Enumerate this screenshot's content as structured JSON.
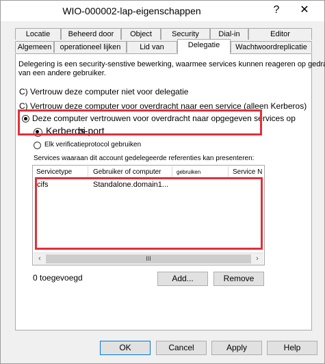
{
  "window": {
    "title": "WIO-000002-lap-eigenschappen",
    "help_glyph": "?",
    "close_glyph": "✕"
  },
  "tabs": {
    "row1": [
      "Locatie",
      "Beheerd door",
      "Object",
      "Security",
      "Dial-in",
      "Editor"
    ],
    "row2": [
      "Algemeen",
      "operationeel lijken",
      "Lid van",
      "Delegatie",
      "Wachtwoordreplicatie"
    ],
    "active": "Delegatie"
  },
  "delegation": {
    "description": "Delegering is een security-senstive bewerking, waarmee services kunnen reageren op gedrag van een andere gebruiker.",
    "description_line1": "Delegering is een security-senstive bewerking, waarmee services kunnen reageren op gedrag",
    "description_line2": "van een andere gebruiker.",
    "option_no_delegation": "C) Vertrouw deze computer niet voor delegatie",
    "option_kerberos_only": "C) Vertrouw deze computer voor overdracht naar een service (alleen Kerberos)",
    "option_specified_services": "Deze computer vertrouwen voor overdracht naar opgegeven services op",
    "sub_kerberos": "Kerberos-port",
    "sub_kerberos_overlay": "bi",
    "sub_any_protocol": "Elk verificatieprotocol gebruiken",
    "services_label": "Services waaraan dit account gedelegeerde referenties kan presenteren:"
  },
  "services_table": {
    "columns": [
      "Servicetype",
      "Gebruiker of computer",
      "gebruiken",
      "Service N"
    ],
    "rows": [
      {
        "service_type": "cifs",
        "user_or_computer": "Standalone.domain1...",
        "port": "",
        "service_name": ""
      }
    ],
    "scroll_left": "‹",
    "scroll_right": "›",
    "scroll_thumb_grip": "III"
  },
  "status": {
    "added_count": "0 toegevoegd"
  },
  "buttons": {
    "add": "Add...",
    "remove": "Remove",
    "ok": "OK",
    "cancel": "Cancel",
    "apply": "Apply",
    "help": "Help"
  },
  "colors": {
    "highlight_box": "#e0303a",
    "default_button_border": "#0078d7"
  }
}
